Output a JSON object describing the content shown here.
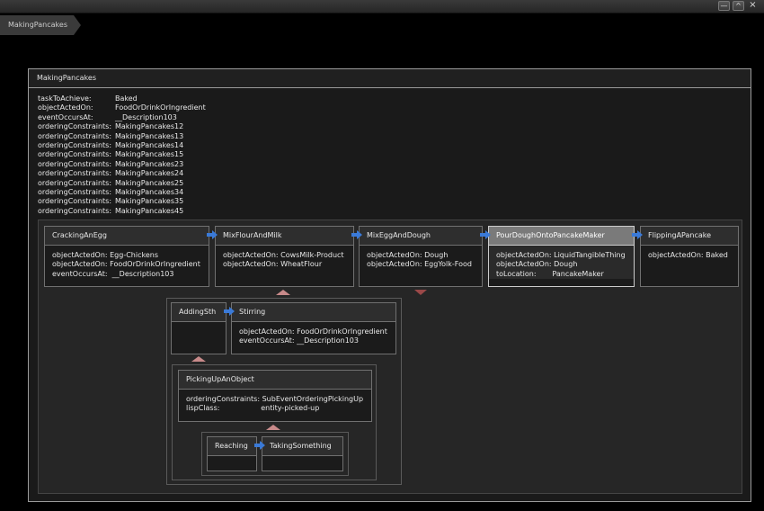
{
  "breadcrumb": {
    "item": "MakingPancakes"
  },
  "window_controls": {
    "minimize": "—",
    "maximize": "^",
    "close": "×"
  },
  "panel": {
    "title": "MakingPancakes",
    "properties": [
      {
        "key": "taskToAchieve:",
        "value": "Baked"
      },
      {
        "key": "objectActedOn:",
        "value": "FoodOrDrinkOrIngredient"
      },
      {
        "key": "eventOccursAt:",
        "value": "__Description103"
      },
      {
        "key": "orderingConstraints:",
        "value": "MakingPancakes12"
      },
      {
        "key": "orderingConstraints:",
        "value": "MakingPancakes13"
      },
      {
        "key": "orderingConstraints:",
        "value": "MakingPancakes14"
      },
      {
        "key": "orderingConstraints:",
        "value": "MakingPancakes15"
      },
      {
        "key": "orderingConstraints:",
        "value": "MakingPancakes23"
      },
      {
        "key": "orderingConstraints:",
        "value": "MakingPancakes24"
      },
      {
        "key": "orderingConstraints:",
        "value": "MakingPancakes25"
      },
      {
        "key": "orderingConstraints:",
        "value": "MakingPancakes34"
      },
      {
        "key": "orderingConstraints:",
        "value": "MakingPancakes35"
      },
      {
        "key": "orderingConstraints:",
        "value": "MakingPancakes45"
      }
    ]
  },
  "nodes": {
    "cracking": {
      "title": "CrackingAnEgg",
      "rows": [
        {
          "key": "objectActedOn: ",
          "value": "Egg-Chickens"
        },
        {
          "key": "objectActedOn: ",
          "value": "FoodOrDrinkOrIngredient"
        },
        {
          "key": "eventOccursAt:  ",
          "value": "__Description103"
        }
      ]
    },
    "mixflour": {
      "title": "MixFlourAndMilk",
      "rows": [
        {
          "key": "objectActedOn: ",
          "value": "CowsMilk-Product"
        },
        {
          "key": "objectActedOn: ",
          "value": "WheatFlour"
        }
      ]
    },
    "mixegg": {
      "title": "MixEggAndDough",
      "rows": [
        {
          "key": "objectActedOn: ",
          "value": "Dough"
        },
        {
          "key": "objectActedOn: ",
          "value": "EggYolk-Food"
        }
      ]
    },
    "pour": {
      "title": "PourDoughOntoPancakeMaker",
      "rows": [
        {
          "key": "objectActedOn: ",
          "value": "LiquidTangibleThing"
        },
        {
          "key": "objectActedOn: ",
          "value": "Dough"
        },
        {
          "key": "toLocation:       ",
          "value": "PancakeMaker"
        }
      ]
    },
    "flipping": {
      "title": "FlippingAPancake",
      "rows": [
        {
          "key": "objectActedOn: ",
          "value": "Baked"
        }
      ]
    },
    "adding": {
      "title": "AddingSth",
      "rows": []
    },
    "stirring": {
      "title": "Stirring",
      "rows": [
        {
          "key": "objectActedOn: ",
          "value": "FoodOrDrinkOrIngredient"
        },
        {
          "key": "eventOccursAt: ",
          "value": "__Description103"
        }
      ]
    },
    "picking": {
      "title": "PickingUpAnObject",
      "rows": [
        {
          "key": "orderingConstraints: ",
          "value": "SubEventOrderingPickingUp"
        },
        {
          "key": "lispClass:                  ",
          "value": "entity-picked-up"
        }
      ]
    },
    "reaching": {
      "title": "Reaching",
      "rows": []
    },
    "taking": {
      "title": "TakingSomething",
      "rows": []
    }
  },
  "colors": {
    "arrow": "#3a7ad8",
    "expand_marker": "#c88a8a",
    "collapse_marker": "#9a4848",
    "selected_header": "#7a7a7a"
  }
}
